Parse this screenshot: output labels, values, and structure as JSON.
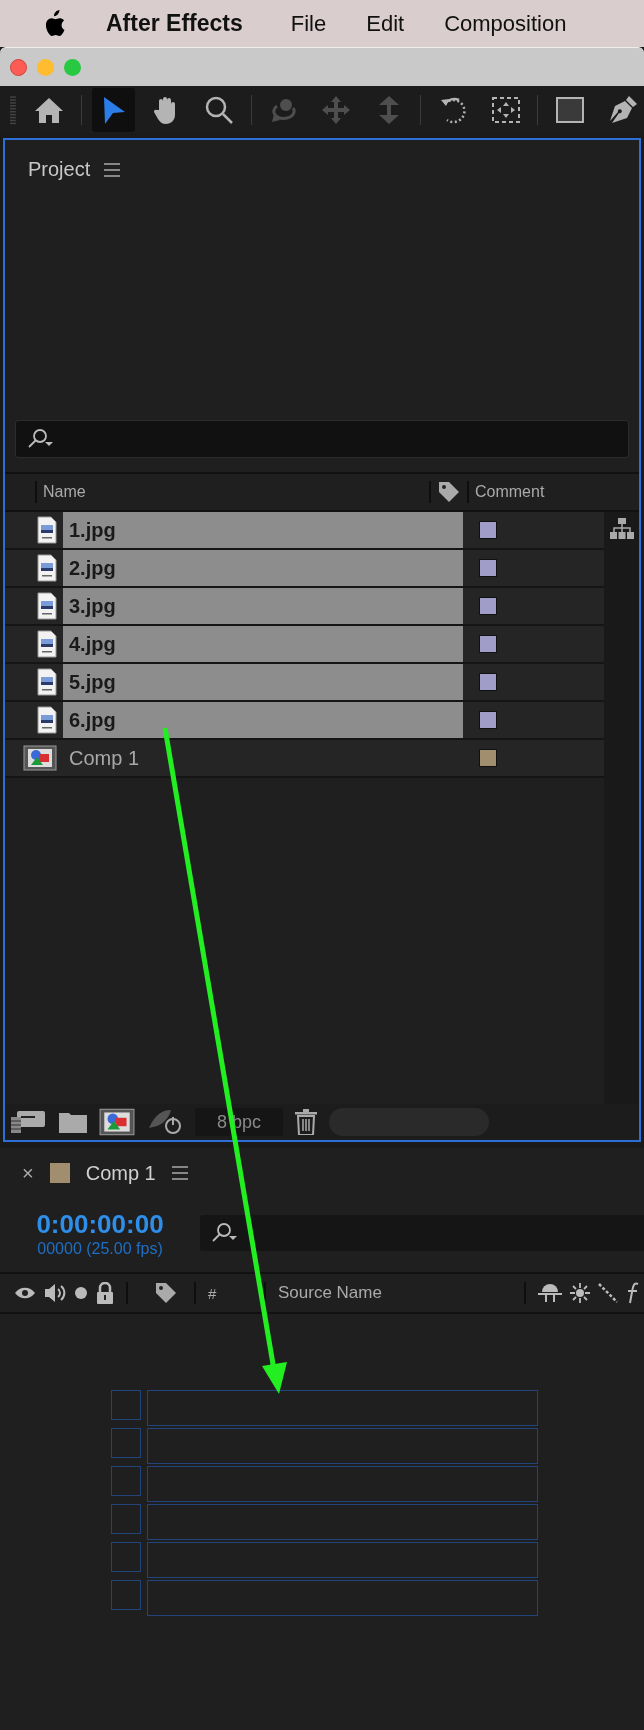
{
  "menu_bar": {
    "app": "After Effects",
    "items": [
      "File",
      "Edit",
      "Composition"
    ]
  },
  "toolbar": {
    "tools": [
      {
        "kind": "home",
        "selected": false,
        "disabled": false
      },
      {
        "kind": "selection",
        "selected": true,
        "disabled": false
      },
      {
        "kind": "hand",
        "selected": false,
        "disabled": false
      },
      {
        "kind": "zoom",
        "selected": false,
        "disabled": false
      },
      {
        "kind": "orbit",
        "selected": false,
        "disabled": true
      },
      {
        "kind": "pan",
        "selected": false,
        "disabled": true
      },
      {
        "kind": "dolly",
        "selected": false,
        "disabled": true
      },
      {
        "kind": "rotate",
        "selected": false,
        "disabled": false
      },
      {
        "kind": "region",
        "selected": false,
        "disabled": false
      },
      {
        "kind": "rectangle",
        "selected": false,
        "disabled": false
      },
      {
        "kind": "pen",
        "selected": false,
        "disabled": false
      }
    ]
  },
  "project": {
    "title": "Project",
    "columns": {
      "name": "Name",
      "comment": "Comment"
    },
    "items": [
      {
        "name": "1.jpg",
        "kind": "image",
        "selected": true,
        "color": "#a09ec8"
      },
      {
        "name": "2.jpg",
        "kind": "image",
        "selected": true,
        "color": "#a09ec8"
      },
      {
        "name": "3.jpg",
        "kind": "image",
        "selected": true,
        "color": "#a09ec8"
      },
      {
        "name": "4.jpg",
        "kind": "image",
        "selected": true,
        "color": "#a09ec8"
      },
      {
        "name": "5.jpg",
        "kind": "image",
        "selected": true,
        "color": "#a09ec8"
      },
      {
        "name": "6.jpg",
        "kind": "image",
        "selected": true,
        "color": "#a09ec8"
      },
      {
        "name": "Comp 1",
        "kind": "comp",
        "selected": false,
        "color": "#a08e6e"
      }
    ],
    "bit_depth": "8 bpc"
  },
  "composition": {
    "close": "×",
    "title": "Comp 1",
    "color": "#a08e6e",
    "timecode": "0:00:00:00",
    "frame_info": "00000 (25.00 fps)",
    "columns": {
      "number": "#",
      "source": "Source Name"
    }
  }
}
